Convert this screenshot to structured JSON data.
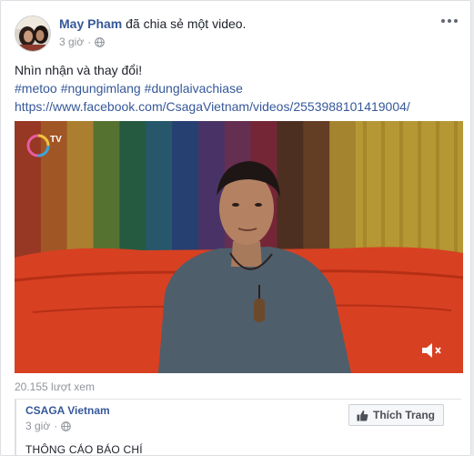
{
  "post": {
    "author": "May Pham",
    "action": "đã chia sẻ một video.",
    "time": "3 giờ",
    "text": "Nhìn nhận và thay đổi!",
    "hashtags": [
      "#metoo",
      "#ngungimlang",
      "#dunglaivachiase"
    ],
    "link": "https://www.facebook.com/CsagaVietnam/videos/2553988101419004/"
  },
  "video": {
    "views": "20.155 lượt xem",
    "muted": true,
    "stripe_colors": [
      "#b8452c",
      "#c56a2e",
      "#d19c3a",
      "#6a8c3c",
      "#2f6e4f",
      "#2f6b83",
      "#2f4f8a",
      "#5a3f7d",
      "#7a3a63",
      "#8f2f43",
      "#5e3a2a",
      "#7b4b2e",
      "#c9a23a"
    ]
  },
  "shared": {
    "page_name": "CSAGA Vietnam",
    "time": "3 giờ",
    "like_button": "Thích Trang",
    "preview_text": "THÔNG CÁO BÁO CHÍ"
  },
  "icons": {
    "globe": "globe-icon",
    "more": "more-options-icon",
    "mute": "volume-muted-icon",
    "like": "thumbs-up-icon"
  }
}
